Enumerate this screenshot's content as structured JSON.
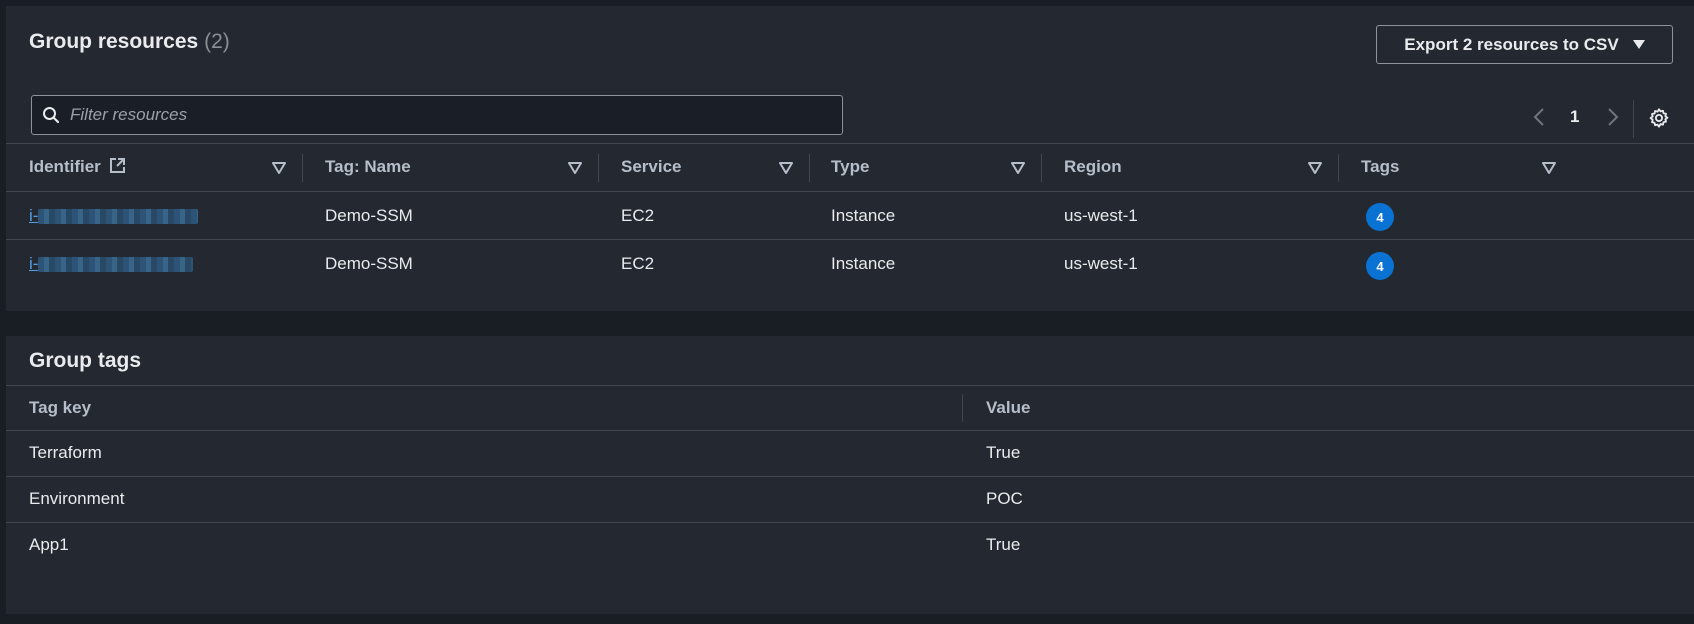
{
  "resources": {
    "title": "Group resources",
    "count": "(2)",
    "export_label": "Export 2 resources to CSV",
    "filter_placeholder": "Filter resources",
    "page_number": "1",
    "columns": [
      "Identifier",
      "Tag: Name",
      "Service",
      "Type",
      "Region",
      "Tags"
    ],
    "rows": [
      {
        "identifier_prefix": "i-",
        "name": "Demo-SSM",
        "service": "EC2",
        "type": "Instance",
        "region": "us-west-1",
        "tags": "4"
      },
      {
        "identifier_prefix": "i-",
        "name": "Demo-SSM",
        "service": "EC2",
        "type": "Instance",
        "region": "us-west-1",
        "tags": "4"
      }
    ]
  },
  "group_tags": {
    "title": "Group tags",
    "columns": [
      "Tag key",
      "Value"
    ],
    "rows": [
      {
        "key": "Terraform",
        "value": "True"
      },
      {
        "key": "Environment",
        "value": "POC"
      },
      {
        "key": "App1",
        "value": "True"
      }
    ]
  },
  "colors": {
    "background": "#191d24",
    "panel": "#232831",
    "link": "#539fe5",
    "badge": "#0972d3",
    "divider": "#414750"
  },
  "icons": [
    "search-icon",
    "external-link-icon",
    "sort-icon",
    "chevron-left-icon",
    "chevron-right-icon",
    "settings-gear-icon",
    "caret-down-icon"
  ]
}
